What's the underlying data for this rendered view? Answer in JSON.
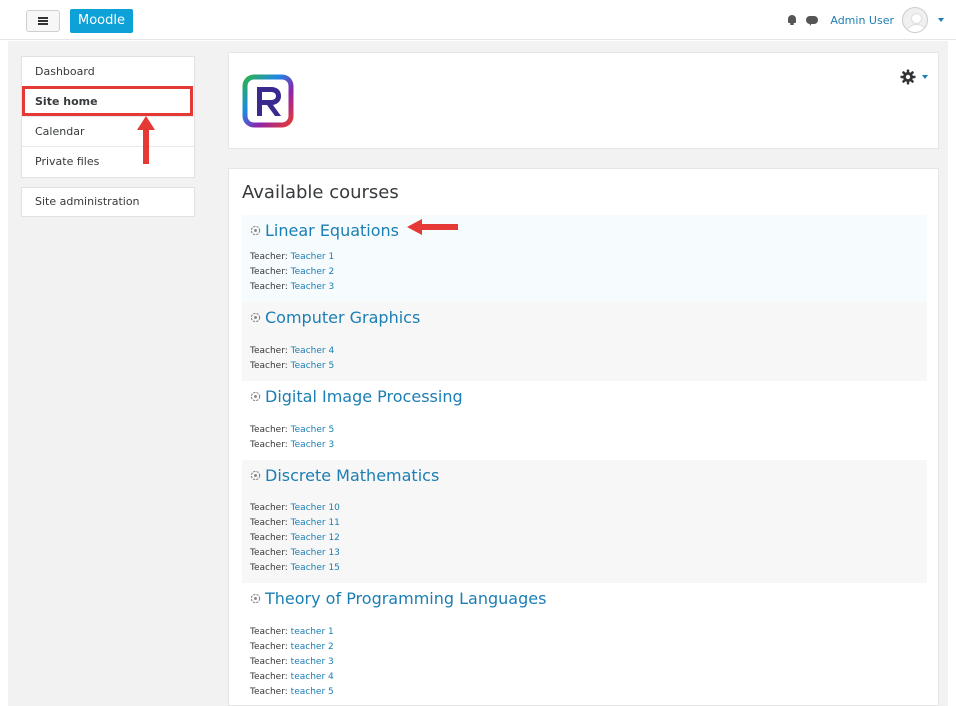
{
  "navbar": {
    "brand": "Moodle",
    "user_name": "Admin User"
  },
  "sidebar": {
    "items": [
      {
        "label": "Dashboard"
      },
      {
        "label": "Site home"
      },
      {
        "label": "Calendar"
      },
      {
        "label": "Private files"
      }
    ],
    "admin": {
      "label": "Site administration"
    }
  },
  "courses": {
    "title": "Available courses",
    "teacher_label": "Teacher:",
    "list": [
      {
        "name": "Linear Equations",
        "teachers": [
          "Teacher 1",
          "Teacher 2",
          "Teacher 3"
        ]
      },
      {
        "name": "Computer Graphics",
        "teachers": [
          "Teacher 4",
          "Teacher 5"
        ]
      },
      {
        "name": "Digital Image Processing",
        "teachers": [
          "Teacher 5",
          "Teacher 3"
        ]
      },
      {
        "name": "Discrete Mathematics",
        "teachers": [
          "Teacher 10",
          "Teacher 11",
          "Teacher 12",
          "Teacher 13",
          "Teacher 15"
        ]
      },
      {
        "name": "Theory of Programming Languages",
        "teachers": [
          "teacher 1",
          "teacher 2",
          "teacher 3",
          "teacher 4",
          "teacher 5"
        ]
      }
    ]
  },
  "colors": {
    "link": "#1b7eb4",
    "brand": "#0da1d7",
    "annotation": "#e53935"
  },
  "icons": {
    "menu": "hamburger-icon",
    "bell": "bell-icon",
    "chat": "chat-icon",
    "gear": "gear-icon",
    "course": "course-icon"
  }
}
